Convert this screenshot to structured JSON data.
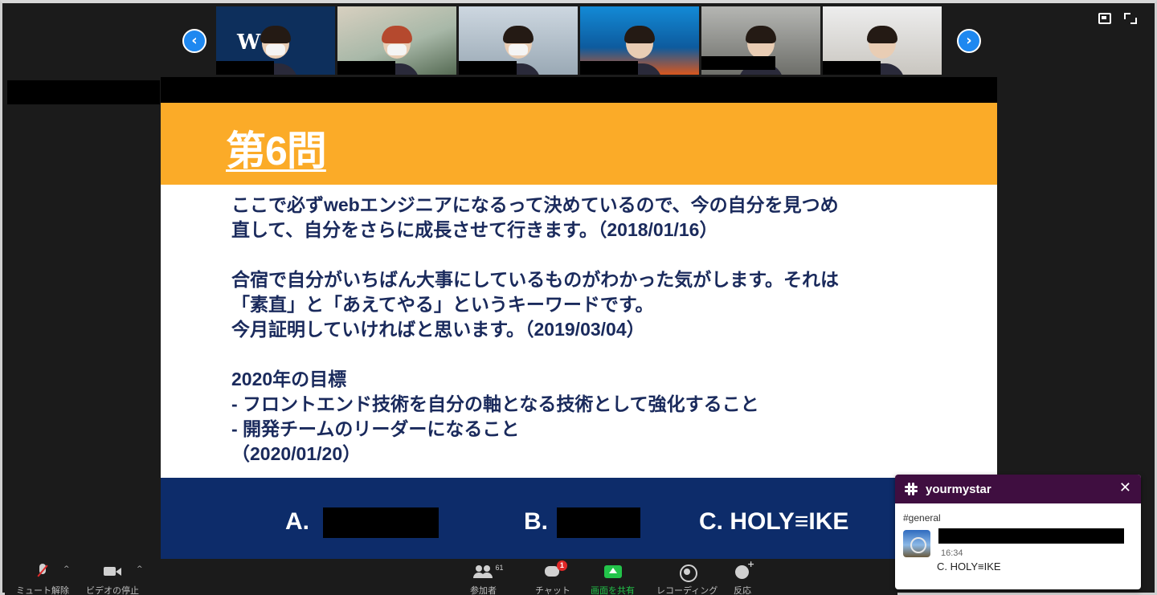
{
  "gallery": {
    "prev_icon": "chevron-left-icon",
    "next_icon": "chevron-right-icon",
    "thumbnails": [
      {
        "overlay_text": "W  T."
      },
      {
        "overlay_text": ""
      },
      {
        "overlay_text": ""
      },
      {
        "overlay_text": ""
      },
      {
        "overlay_text": ""
      },
      {
        "overlay_text": ""
      }
    ]
  },
  "window_controls": {
    "view_icon": "speaker-view-icon",
    "fullscreen_icon": "fullscreen-icon"
  },
  "slide": {
    "title": "第6問",
    "paragraphs": [
      "ここで必ずwebエンジニアになるって決めているので、今の自分を見つめ\n直して、自分をさらに成長させて行きます。（2018/01/16）",
      "合宿で自分がいちばん大事にしているものがわかった気がします。それは\n「素直」と「あえてやる」というキーワードです。\n今月証明していければと思います。（2019/03/04）",
      "2020年の目標\n- フロントエンド技術を自分の軸となる技術として強化すること\n- 開発チームのリーダーになること\n（2020/01/20）"
    ],
    "answers": {
      "a_label": "A.",
      "b_label": "B.",
      "c_label": "C. HOLY≡IKE"
    },
    "colors": {
      "header": "#fbab28",
      "footer": "#0d2c6a",
      "body_text": "#1a2a5c"
    }
  },
  "slack": {
    "workspace": "yourmystar",
    "close_label": "✕",
    "channel": "#general",
    "time": "16:34",
    "message": "C. HOLY≡IKE"
  },
  "toolbar": {
    "mute_label": "ミュート解除",
    "video_label": "ビデオの停止",
    "participants_label": "参加者",
    "participants_count": "61",
    "chat_label": "チャット",
    "chat_badge": "1",
    "share_label": "画面を共有",
    "record_label": "レコーディング",
    "reactions_label": "反応",
    "caret": "^",
    "share_color": "#23c44a"
  }
}
